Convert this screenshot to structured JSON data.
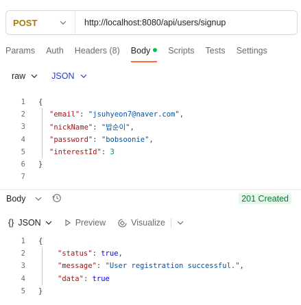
{
  "request": {
    "method": "POST",
    "url": "http://localhost:8080/api/users/signup"
  },
  "tabs": [
    {
      "label": "Params"
    },
    {
      "label": "Auth"
    },
    {
      "label": "Headers (8)"
    },
    {
      "label": "Body"
    },
    {
      "label": "Scripts"
    },
    {
      "label": "Tests"
    },
    {
      "label": "Settings"
    }
  ],
  "body_options": {
    "mode": "raw",
    "format": "JSON"
  },
  "request_body": {
    "line_numbers": [
      "1",
      "2",
      "3",
      "4",
      "5",
      "6",
      "7"
    ],
    "lines": [
      [
        {
          "t": "{",
          "c": "punc"
        }
      ],
      [
        {
          "t": "\"email\"",
          "c": "key"
        },
        {
          "t": ": ",
          "c": "punc"
        },
        {
          "t": "\"jsuhyeon7@naver.com\"",
          "c": "str"
        },
        {
          "t": ",",
          "c": "punc"
        }
      ],
      [
        {
          "t": "\"nickName\"",
          "c": "key"
        },
        {
          "t": ": ",
          "c": "punc"
        },
        {
          "t": "\"밥순이\"",
          "c": "str"
        },
        {
          "t": ",",
          "c": "punc"
        }
      ],
      [
        {
          "t": "\"password\"",
          "c": "key"
        },
        {
          "t": ": ",
          "c": "punc"
        },
        {
          "t": "\"bobsoonie\"",
          "c": "str"
        },
        {
          "t": ",",
          "c": "punc"
        }
      ],
      [
        {
          "t": "\"interestId\"",
          "c": "key"
        },
        {
          "t": ": ",
          "c": "punc"
        },
        {
          "t": "3",
          "c": "num"
        }
      ],
      [
        {
          "t": "}",
          "c": "punc"
        }
      ],
      []
    ]
  },
  "response": {
    "title": "Body",
    "status": "201 Created",
    "toolbar": {
      "format": "JSON",
      "preview": "Preview",
      "visualize": "Visualize"
    },
    "line_numbers": [
      "1",
      "2",
      "3",
      "4",
      "5"
    ],
    "lines": [
      [
        {
          "t": "{",
          "c": "punc"
        }
      ],
      [
        {
          "t": "\"status\"",
          "c": "key"
        },
        {
          "t": ": ",
          "c": "punc"
        },
        {
          "t": "true",
          "c": "bool"
        },
        {
          "t": ",",
          "c": "punc"
        }
      ],
      [
        {
          "t": "\"message\"",
          "c": "key"
        },
        {
          "t": ": ",
          "c": "punc"
        },
        {
          "t": "\"User registration successful.\"",
          "c": "str"
        },
        {
          "t": ",",
          "c": "punc"
        }
      ],
      [
        {
          "t": "\"data\"",
          "c": "key"
        },
        {
          "t": ": ",
          "c": "punc"
        },
        {
          "t": "true",
          "c": "bool"
        }
      ],
      [
        {
          "t": "}",
          "c": "punc"
        }
      ]
    ]
  }
}
